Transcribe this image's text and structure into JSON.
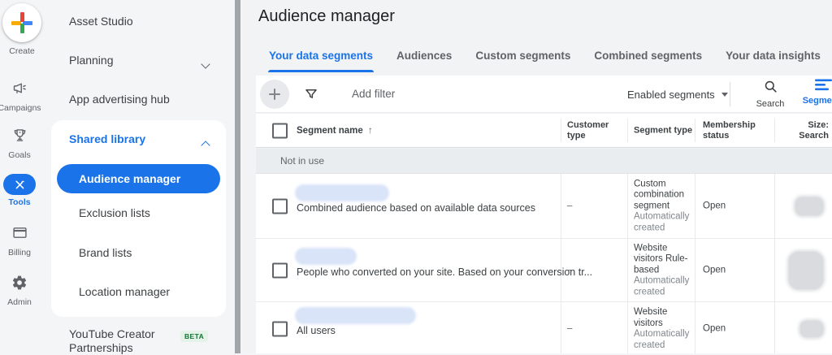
{
  "app": {
    "accent_color": "#1a73e8",
    "selected_pill_color": "#1a73e8",
    "beta_color": "#137333"
  },
  "rail": {
    "create_label": "Create",
    "items": [
      {
        "label": "Campaigns"
      },
      {
        "label": "Goals"
      },
      {
        "label": "Tools"
      },
      {
        "label": "Billing"
      },
      {
        "label": "Admin"
      }
    ]
  },
  "nav": {
    "asset_studio": "Asset Studio",
    "planning": "Planning",
    "app_advertising_hub": "App advertising hub",
    "shared_library": "Shared library",
    "audience_manager": "Audience manager",
    "exclusion_lists": "Exclusion lists",
    "brand_lists": "Brand lists",
    "location_manager": "Location manager",
    "youtube_creator_partnerships": "YouTube Creator Partnerships",
    "beta_badge": "BETA"
  },
  "main": {
    "title": "Audience manager",
    "tabs": [
      {
        "label": "Your data segments",
        "active": true
      },
      {
        "label": "Audiences",
        "active": false
      },
      {
        "label": "Custom segments",
        "active": false
      },
      {
        "label": "Combined segments",
        "active": false
      },
      {
        "label": "Your data insights",
        "active": false
      }
    ]
  },
  "toolbar": {
    "add_filter_label": "Add filter",
    "enabled_segments_label": "Enabled segments",
    "search_label": "Search",
    "segments_label": "Segments"
  },
  "table": {
    "sort_icon": "↑",
    "columns": {
      "segment_name": "Segment name",
      "customer_type": "Customer type",
      "segment_type": "Segment type",
      "membership_status": "Membership status",
      "size_search": "Size: Search"
    },
    "group_label": "Not in use",
    "rows": [
      {
        "description": "Combined audience based on available data sources",
        "customer_type": "–",
        "segment_type_primary": "Custom combination segment",
        "segment_type_secondary": "Automatically created",
        "membership_status": "Open"
      },
      {
        "description": "People who converted on your site. Based on your conversion tr...",
        "customer_type": "–",
        "segment_type_primary": "Website visitors Rule-based",
        "segment_type_secondary": "Automatically created",
        "membership_status": "Open"
      },
      {
        "description": "All users",
        "customer_type": "–",
        "segment_type_primary": "Website visitors",
        "segment_type_secondary": "Automatically created",
        "membership_status": "Open"
      }
    ]
  }
}
